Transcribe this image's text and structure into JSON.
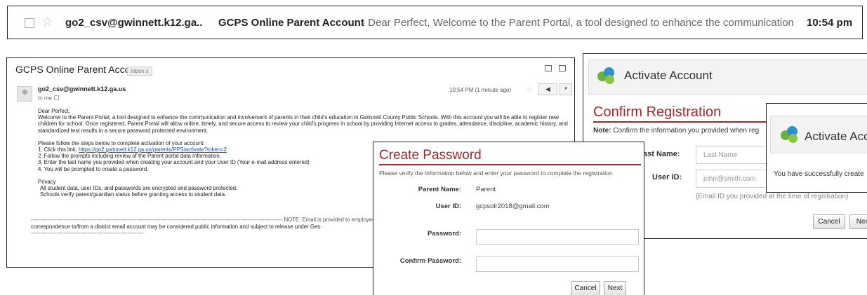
{
  "inbox_row": {
    "sender": "go2_csv@gwinnett.k12.ga..",
    "subject": "GCPS Online Parent Account",
    "snippet": " - Dear Perfect, Welcome to the Parent Portal, a tool designed to enhance the communication and invo",
    "time": "10:54 pm"
  },
  "email": {
    "subject": "GCPS Online Parent Account",
    "label": "Inbox x",
    "from": "go2_csv@gwinnett.k12.ga.us",
    "to": "to me",
    "time": "10:54 PM (1 minute ago)",
    "greeting": "Dear Perfect,",
    "para1": "Welcome to the Parent Portal, a tool designed to enhance the communication and involvement of parents in their child's education in Gwinnett County Public Schools. With this account you will be able to register new children for school.  Once registered, Parent Portal will allow online, timely, and secure access to review your child's progress in school by providing Internet access to grades, attendance, discipline, academic history, and standardized test results in a secure password protected environment.",
    "steps_intro": "Please follow the steps below to complete activation of your account:",
    "step1_prefix": "1. Click this link: ",
    "step1_link": "https://go2.gwinnett.k12.ga.us/parents/PPS/activate?token=2",
    "step2": "2. Follow the prompts including review of the Parent portal data information.",
    "step3": "3. Enter the last name you provided when creating your account and your User ID (Your e-mail address entered)",
    "step4": "4. You will be prompted to create a password.",
    "privacy_title": "Privacy",
    "privacy1": "All student data, user IDs, and passwords are encrypted and password protected.",
    "privacy2": "Schools verify parent/guardian status before granting access to student data.",
    "note_line": "------------------------------------------------------------------------------------------------------------------------------------------ NOTE: Email is provided to employees for the i",
    "note_line2": "correspondence to/from a district email account may be considered public information and subject to release under Geo",
    "note_line3": "--------------------------------------------------------------"
  },
  "confirm": {
    "header": "Activate Account",
    "title": "Confirm Registration",
    "note_bold": "Note:",
    "note_text": " Confirm the information you provided when reg",
    "last_name_label": "ast Name:",
    "last_name_placeholder": "Last Name",
    "user_id_label": "User ID:",
    "user_id_placeholder": "john@smith.com",
    "hint": "(Email ID you provided at the time of registration)",
    "cancel": "Cancel",
    "next": "Next"
  },
  "success": {
    "header": "Activate Acc",
    "message": "You have successfully create"
  },
  "password": {
    "title": "Create Password",
    "instructions": "Please verify the information below and enter your password to complete the registration",
    "parent_name_label": "Parent Name:",
    "parent_name_value": "Parent",
    "user_id_label": "User ID:",
    "user_id_value": "gcpsolr2018@gmail.com",
    "password_label": "Password:",
    "confirm_label": "Confirm Password:",
    "cancel": "Cancel",
    "next": "Next"
  },
  "colors": {
    "brand_red": "#a5282f",
    "link": "#1155cc"
  }
}
